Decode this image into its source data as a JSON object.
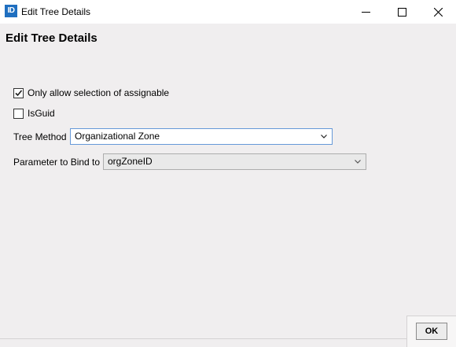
{
  "window": {
    "title": "Edit Tree Details",
    "app_icon_text": "ID",
    "accent_color": "#1f6fc0"
  },
  "header": {
    "title": "Edit Tree Details"
  },
  "options": {
    "assignable": {
      "label": "Only allow selection of assignable",
      "checked": true
    },
    "isguid": {
      "label": "IsGuid",
      "checked": false
    }
  },
  "fields": {
    "tree_method": {
      "label": "Tree Method",
      "value": "Organizational Zone"
    },
    "parameter": {
      "label": "Parameter to Bind to",
      "value": "orgZoneID"
    }
  },
  "footer": {
    "ok_label": "OK"
  },
  "icons": {
    "minimize": "minimize-icon",
    "maximize": "maximize-icon",
    "close": "close-icon",
    "chevron": "chevron-down-icon",
    "check": "checkmark-icon"
  }
}
